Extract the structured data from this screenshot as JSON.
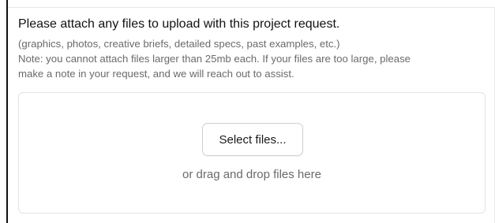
{
  "upload": {
    "title": "Please attach any files to upload with this project request.",
    "help_lines": [
      "(graphics, photos, creative briefs, detailed specs, past examples, etc.)",
      "Note: you cannot attach files larger than 25mb each. If your files are too large, please",
      "make a note in your request, and we will reach out to assist."
    ],
    "select_button_label": "Select files...",
    "drop_hint": "or drag and drop files here"
  }
}
